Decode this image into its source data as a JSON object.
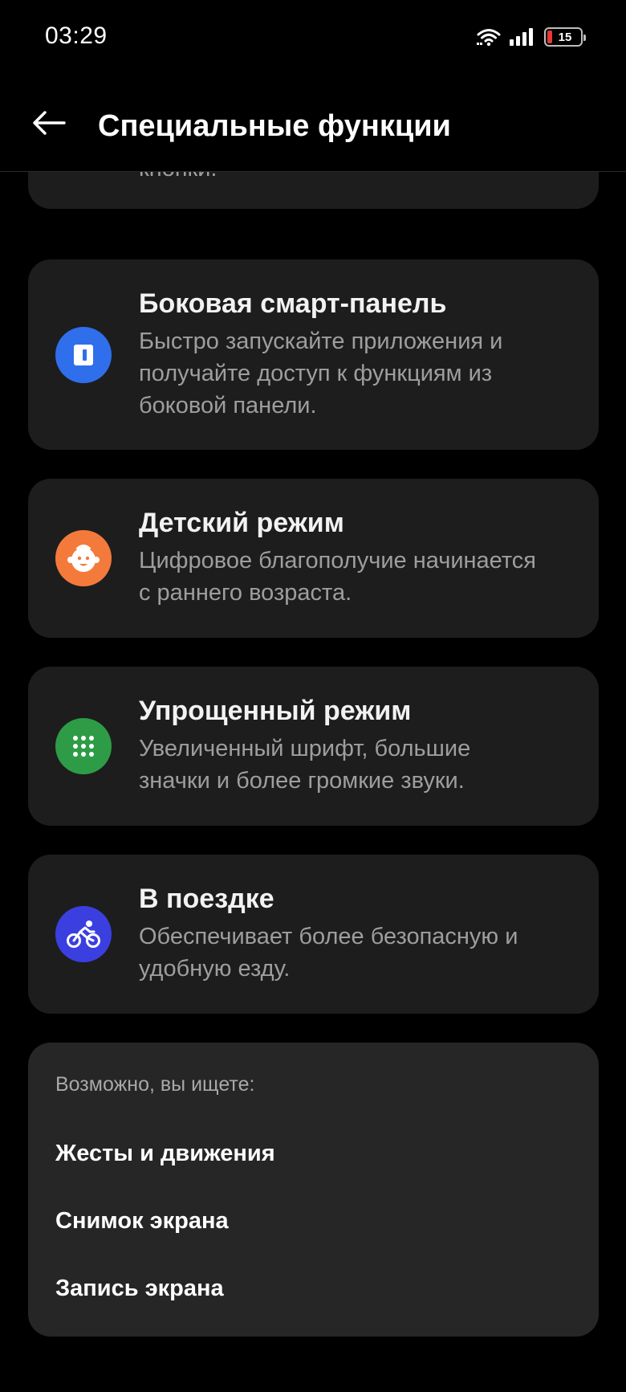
{
  "status_bar": {
    "time": "03:29",
    "battery_level": "15",
    "battery_fraction": 0.15,
    "icons": [
      "wifi-icon",
      "signal-icon",
      "battery-icon"
    ]
  },
  "app_bar": {
    "title": "Специальные функции",
    "back_icon": "arrow-left-icon"
  },
  "cards": [
    {
      "id": "partial",
      "desc": "кнопки."
    },
    {
      "id": "smart-sidebar",
      "icon": "sidebar-icon",
      "icon_color": "#2f6fec",
      "title": "Боковая смарт-панель",
      "desc": [
        "Быстро запускайте приложения и",
        "получайте доступ к функциям из",
        "боковой панели."
      ]
    },
    {
      "id": "kids-mode",
      "icon": "child-face-icon",
      "icon_color": "#f47a3c",
      "title": "Детский режим",
      "desc": [
        "Цифровое благополучие начинается",
        "с раннего возраста."
      ]
    },
    {
      "id": "simple-mode",
      "icon": "grid-dots-icon",
      "icon_color": "#2e9c47",
      "title": "Упрощенный режим",
      "desc": [
        "Увеличенный шрифт, большие",
        "значки и более громкие звуки."
      ]
    },
    {
      "id": "riding-mode",
      "icon": "bicycle-icon",
      "icon_color": "#3b3fe0",
      "title": "В поездке",
      "desc": [
        "Обеспечивает более безопасную и",
        "удобную езду."
      ]
    }
  ],
  "suggestions": {
    "header": "Возможно, вы ищете:",
    "links": [
      "Жесты и движения",
      "Снимок экрана",
      "Запись экрана"
    ]
  },
  "colors": {
    "background": "#000000",
    "card": "#1d1d1d",
    "suggest_card": "#262626",
    "title_text": "#f2f2f2",
    "desc_text": "#9e9e9e"
  }
}
